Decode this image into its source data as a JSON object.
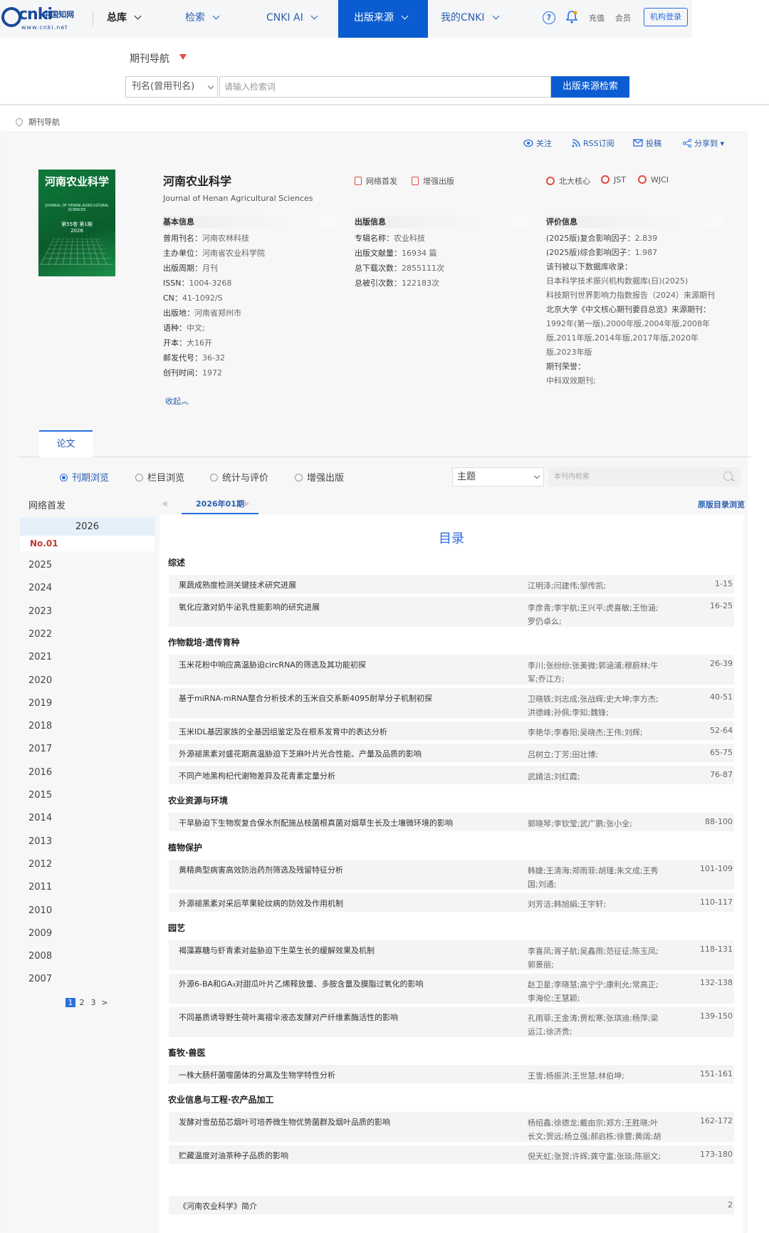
{
  "nav": {
    "logo_main": "cnki",
    "logo_cn": "中国知网",
    "logo_url": "www.cnki.net",
    "zongku": "总库",
    "items": [
      "检索",
      "CNKI AI",
      "出版来源",
      "我的CNKI"
    ],
    "help": "?",
    "recharge": "充值",
    "member": "会员",
    "org_login": "机构登录"
  },
  "search": {
    "nav_label": "期刊导航",
    "field": "刊名(曾用刊名)",
    "placeholder": "请输入检索词",
    "button": "出版来源检索"
  },
  "breadcrumb": "期刊导航",
  "actions": [
    "关注",
    "RSS订阅",
    "投稿",
    "分享到"
  ],
  "journal": {
    "cover_title": "河南农业科学",
    "cover_en": "JOURNAL OF HENAN AGRICULTURAL SCIENCES",
    "cover_issue": "第55卷 第1期",
    "cover_year": "2026",
    "title": "河南农业科学",
    "title_en": "Journal of Henan Agricultural Sciences",
    "badges_left": [
      "网络首发",
      "增强出版"
    ],
    "badges_right": [
      "北大核心",
      "JST",
      "WJCI"
    ]
  },
  "basic_info": {
    "heading": "基本信息",
    "rows": [
      {
        "k": "曾用刊名：",
        "v": "河南农林科技"
      },
      {
        "k": "主办单位：",
        "v": "河南省农业科学院"
      },
      {
        "k": "出版周期：",
        "v": "月刊"
      },
      {
        "k": "ISSN：",
        "v": "1004-3268"
      },
      {
        "k": "CN：",
        "v": "41-1092/S"
      },
      {
        "k": "出版地：",
        "v": "河南省郑州市"
      },
      {
        "k": "语种：",
        "v": "中文;"
      },
      {
        "k": "开本：",
        "v": "大16开"
      },
      {
        "k": "邮发代号：",
        "v": "36-32"
      },
      {
        "k": "创刊时间：",
        "v": "1972"
      }
    ]
  },
  "pub_info": {
    "heading": "出版信息",
    "rows": [
      {
        "k": "专辑名称：",
        "v": "农业科技"
      },
      {
        "k": "出版文献量：",
        "v": "16934 篇"
      },
      {
        "k": "总下载次数：",
        "v": "2855111次"
      },
      {
        "k": "总被引次数：",
        "v": "122183次"
      }
    ]
  },
  "eval_info": {
    "heading": "评价信息",
    "composite_k": "(2025版)复合影响因子：",
    "composite_v": "2.839",
    "overall_k": "(2025版)综合影响因子：",
    "overall_v": "1.987",
    "db_label": "该刊被以下数据库收录：",
    "db1": "日本科学技术振兴机构数据库(日)(2025)",
    "db2": "科技期刊世界影响力指数报告（2024）来源期刊",
    "pku": "北京大学《中文核心期刊要目总览》来源期刊：",
    "pku_years": "1992年(第一版),2000年版,2004年版,2008年版,2011年版,2014年版,2017年版,2020年版,2023年版",
    "honor_label": "期刊荣誉：",
    "honor": "中科双效期刊;"
  },
  "collapse": "收起︽",
  "tabs": {
    "paper": "论文"
  },
  "browse": {
    "options": [
      "刊期浏览",
      "栏目浏览",
      "统计与评价",
      "增强出版"
    ],
    "topic": "主题",
    "inner_placeholder": "本刊内检索"
  },
  "years": {
    "net_first": "网络首发",
    "active": "2026",
    "issue": "No.01",
    "list": [
      "2025",
      "2024",
      "2023",
      "2022",
      "2021",
      "2020",
      "2019",
      "2018",
      "2017",
      "2016",
      "2015",
      "2014",
      "2013",
      "2012",
      "2011",
      "2010",
      "2009",
      "2008",
      "2007"
    ],
    "pages": [
      "1",
      "2",
      "3",
      ">"
    ]
  },
  "issue": {
    "current": "2026年01期",
    "orig": "原版目录浏览",
    "toc_title": "目录"
  },
  "toc": {
    "cats": [
      "综述",
      "作物栽培·遗传育种",
      "农业资源与环境",
      "植物保护",
      "园艺",
      "畜牧·兽医",
      "农业信息与工程·农产品加工"
    ],
    "rows": [
      {
        "t": "果蔬成熟度检测关键技术研究进展",
        "a": "江明泽;闫建伟;邹传凯;",
        "p": "1-15"
      },
      {
        "t": "氧化应激对奶牛泌乳性能影响的研究进展",
        "a": "李彦青;李宇航;王兴平;虎喜敏;王怡涵;罗仍卓么;",
        "p": "16-25"
      },
      {
        "t": "玉米花粉中响应高温胁迫circRNA的筛选及其功能初探",
        "a": "李川;张纷纷;张美微;郭涵浦;穆蔚林;牛军;乔江方;",
        "p": "26-39"
      },
      {
        "t": "基于miRNA-mRNA整合分析技术的玉米自交系新4095耐旱分子机制初探",
        "a": "卫晓轶;刘志成;张战辉;史大坤;李方杰;洪德峰;孙佩;李知;魏锋;",
        "p": "40-51"
      },
      {
        "t": "玉米IDL基因家族的全基因组鉴定及在根系发育中的表达分析",
        "a": "李艳华;李春阳;吴晓杰;王伟;刘辉;",
        "p": "52-64"
      },
      {
        "t": "外源褪黑素对盛花期高温胁迫下芝麻叶片光合性能、产量及品质的影响",
        "a": "吕树立;丁芳;田壮博;",
        "p": "65-75"
      },
      {
        "t": "不同产地黑枸杞代谢物差异及花青素定量分析",
        "a": "武婧洁;刘红霞;",
        "p": "76-87"
      },
      {
        "t": "干旱胁迫下生物炭复合保水剂配施丛枝菌根真菌对烟草生长及土壤微环境的影响",
        "a": "郭晓琴;李钦莹;武广鹏;张小全;",
        "p": "88-100"
      },
      {
        "t": "黄精典型病害高效防治药剂筛选及残留特征分析",
        "a": "韩婕;王清海;郑雨菲;胡瑾;朱文成;王秀国;刘通;",
        "p": "101-109"
      },
      {
        "t": "外源褪黑素对采后苹果轮纹病的防效及作用机制",
        "a": "刘芳洁;韩旭娟;王宇轩;",
        "p": "110-117"
      },
      {
        "t": "褐藻寡糖与虾青素对盐胁迫下生菜生长的缓解效果及机制",
        "a": "李喜凤;胥子航;吴鑫雨;范征征;陈玉凤;郭景丽;",
        "p": "118-131"
      },
      {
        "t": "外源6-BA和GA₃对甜瓜叶片乙烯释放量、多胺含量及膜脂过氧化的影响",
        "a": "赵卫星;李晓慧;高宁宁;康利允;常高正;李海伦;王慧颖;",
        "p": "132-138"
      },
      {
        "t": "不同基质诱导野生荷叶离褶伞液态发酵对产纤维素酶活性的影响",
        "a": "孔雨菲;王金涛;贾松寒;张琪迪;杨萍;梁运江;徐济贵;",
        "p": "139-150"
      },
      {
        "t": "一株大肠杆菌噬菌体的分离及生物学特性分析",
        "a": "王雪;杨振洪;王世慧;林伯坤;",
        "p": "151-161"
      },
      {
        "t": "发酵对雪茄茄芯烟叶可培养微生物优势菌群及烟叶品质的影响",
        "a": "杨绍鑫;徐德龙;戴由宗;郑方;王胜晓;叶长文;贺远;杨立强;郝启栋;徐豐;黄阔;胡廷奇;",
        "p": "162-172"
      },
      {
        "t": "贮藏温度对油茶种子品质的影响",
        "a": "倪天虹;张贺;许辉;龚守富;张琰;陈丽文;",
        "p": "173-180"
      },
      {
        "t": "《河南农业科学》简介",
        "a": "",
        "p": "2"
      }
    ]
  }
}
